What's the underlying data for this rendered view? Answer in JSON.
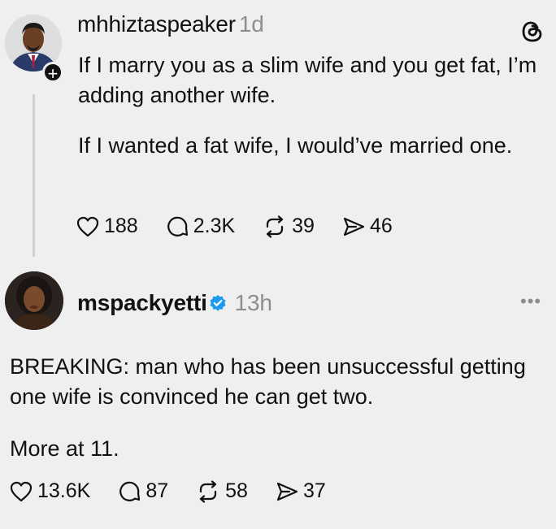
{
  "post1": {
    "username": "mhhiztaspeaker",
    "time": "1d",
    "paragraph1": "If I marry you as a slim wife and you get fat, I’m adding another wife.",
    "paragraph2": "If I wanted a fat wife, I would’ve married one.",
    "likes": "188",
    "replies": "2.3K",
    "reposts": "39",
    "shares": "46"
  },
  "post2": {
    "username": "mspackyetti",
    "time": "13h",
    "paragraph1": "BREAKING: man who has been unsuccessful getting one wife is convinced he can get two.",
    "paragraph2": "More at 11.",
    "likes": "13.6K",
    "replies": "87",
    "reposts": "58",
    "shares": "37"
  },
  "icons": {
    "logo": "threads-logo-icon",
    "like": "heart-icon",
    "reply": "comment-icon",
    "repost": "repost-icon",
    "share": "share-icon",
    "verified": "verified-badge-icon",
    "more": "more-options-icon",
    "follow": "plus-icon"
  },
  "colors": {
    "background": "#efefef",
    "text": "#111111",
    "muted": "#8e8e8e",
    "verified": "#1d9bf0"
  }
}
